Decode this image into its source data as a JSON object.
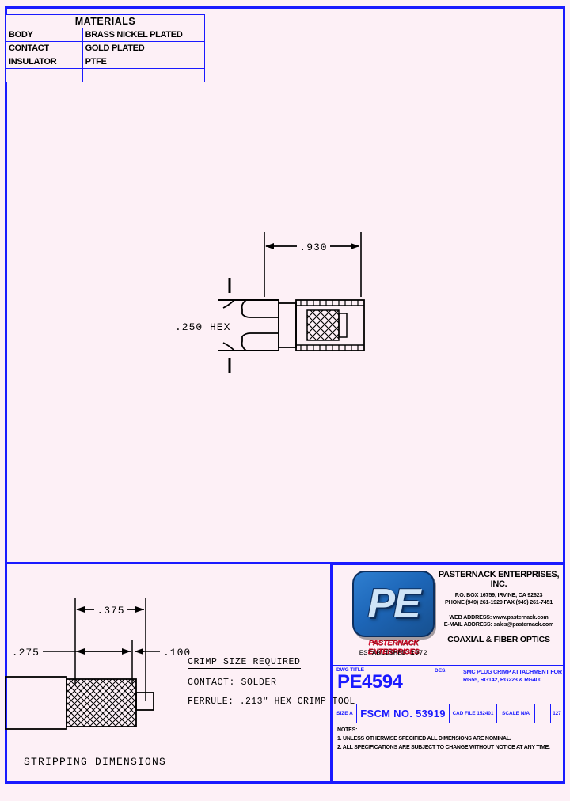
{
  "materials": {
    "header": "MATERIALS",
    "rows": [
      {
        "label": "BODY",
        "value": "BRASS NICKEL PLATED"
      },
      {
        "label": "CONTACT",
        "value": "GOLD PLATED"
      },
      {
        "label": "INSULATOR",
        "value": "PTFE"
      },
      {
        "label": "",
        "value": ""
      }
    ]
  },
  "main_view": {
    "length_dim": ".930",
    "hex_dim": ".250 HEX"
  },
  "stripping": {
    "caption": "STRIPPING DIMENSIONS",
    "dim_total": ".375",
    "dim_mid": ".275",
    "dim_tip": ".100"
  },
  "crimp": {
    "title": "CRIMP SIZE REQUIRED",
    "contact": "CONTACT: SOLDER",
    "ferrule": "FERRULE: .213\" HEX CRIMP TOOL"
  },
  "company": {
    "name": "PASTERNACK ENTERPRISES, INC.",
    "address": "P.O. BOX 16759, IRVINE, CA 92623",
    "phone": "PHONE (949) 261-1920 FAX (949) 261-7451",
    "web": "WEB ADDRESS: www.pasternack.com",
    "email": "E-MAIL ADDRESS: sales@pasternack.com",
    "tagline": "COAXIAL & FIBER OPTICS",
    "logo_initials": "PE",
    "logo_name": "PASTERNACK ENTERPRISES",
    "logo_est": "ESTABLISHED 1972"
  },
  "title_block": {
    "dwg_title_label": "DWG TITLE",
    "part_number": "PE4594",
    "des_label": "DES.",
    "description": "SMC PLUG CRIMP ATTACHMENT FOR RG55, RG142, RG223 & RG400",
    "size": "SIZE A",
    "fscm": "FSCM NO. 53919",
    "cad_file": "CAD FILE   152401",
    "scale": "SCALE N/A",
    "blank": "",
    "rev": "127"
  },
  "notes": {
    "header": "NOTES:",
    "note1": "1.  UNLESS OTHERWISE SPECIFIED ALL DIMENSIONS ARE NOMINAL.",
    "note2": "2.  ALL SPECIFICATIONS ARE SUBJECT TO CHANGE WITHOUT NOTICE AT ANY TIME."
  },
  "colors": {
    "frame": "#1a1aff",
    "background": "#fdf0f6",
    "logo_blue": "#1d66b8",
    "logo_red": "#d81030"
  }
}
